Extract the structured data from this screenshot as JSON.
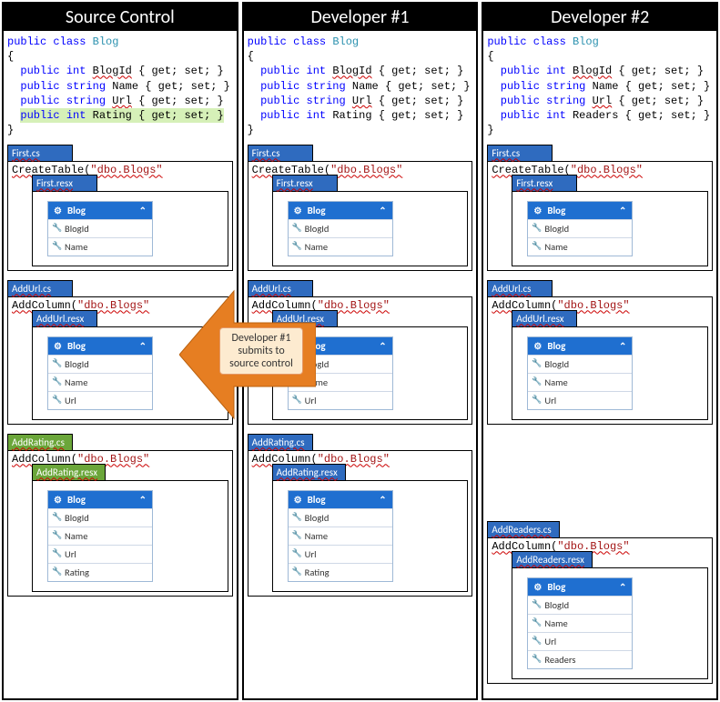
{
  "columns": {
    "source": {
      "title": "Source Control"
    },
    "dev1": {
      "title": "Developer #1"
    },
    "dev2": {
      "title": "Developer #2"
    }
  },
  "code": {
    "decl_public": "public",
    "decl_class": "class",
    "decl_blog": "Blog",
    "brace_open": "{",
    "brace_close": "}",
    "int": "int",
    "string": "string",
    "get_set": "{ get; set; }",
    "BlogId": "BlogId",
    "Name": "Name",
    "Url": "Url",
    "Rating": "Rating",
    "Readers": "Readers"
  },
  "files": {
    "first_cs": "First.cs",
    "first_resx": "First.resx",
    "addurl_cs": "AddUrl.cs",
    "addurl_resx": "AddUrl.resx",
    "addrating_cs": "AddRating.cs",
    "addrating_resx": "AddRating.resx",
    "addreaders_cs": "AddReaders.cs",
    "addreaders_resx": "AddReaders.resx",
    "create_table": "CreateTable(",
    "add_column": "AddColumn(",
    "dbo_blogs": "\"dbo.Blogs\""
  },
  "card": {
    "title": "Blog",
    "fields": {
      "BlogId": "BlogId",
      "Name": "Name",
      "Url": "Url",
      "Rating": "Rating",
      "Readers": "Readers"
    }
  },
  "arrow": {
    "label": "Developer #1 submits to source control"
  }
}
